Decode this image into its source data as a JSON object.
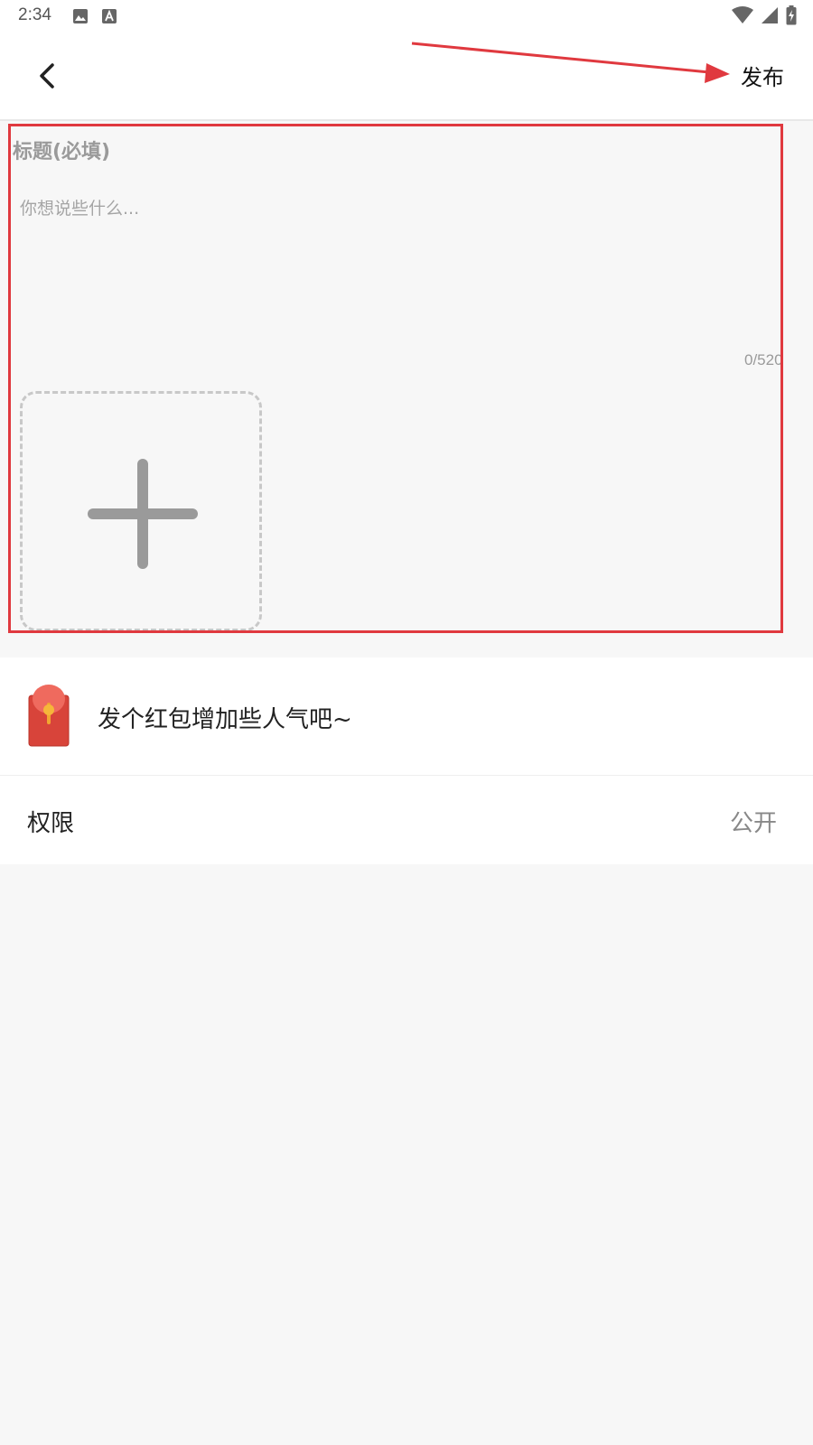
{
  "status_bar": {
    "time": "2:34",
    "left_icons": [
      "image-icon",
      "text-a-icon"
    ],
    "right_icons": [
      "wifi-icon",
      "signal-icon",
      "battery-charging-icon"
    ]
  },
  "app_bar": {
    "back_icon": "chevron-left-icon",
    "publish_label": "发布"
  },
  "composer": {
    "title_placeholder": "标题(必填)",
    "title_value": "",
    "content_placeholder": "你想说些什么...",
    "content_value": "",
    "char_counter": "0/520",
    "add_image_icon": "plus-icon"
  },
  "options": {
    "red_packet": {
      "icon": "red-packet-icon",
      "label": "发个红包增加些人气吧~"
    },
    "permission": {
      "label": "权限",
      "value": "公开"
    }
  },
  "colors": {
    "annotation_red": "#e0393f",
    "background": "#f7f7f7",
    "placeholder_gray": "#9a9a9a"
  }
}
